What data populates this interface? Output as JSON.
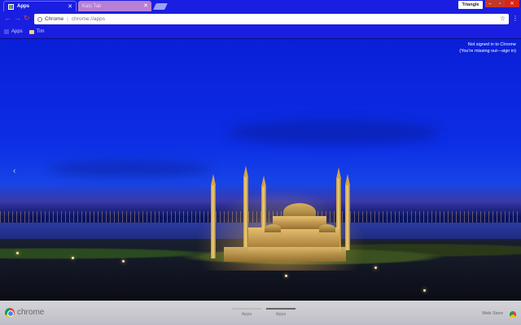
{
  "tabs": [
    {
      "label": "Apps",
      "active": true
    },
    {
      "label": "Kats Tab",
      "active": false
    }
  ],
  "profile": {
    "label": "Triangle"
  },
  "omnibox": {
    "chip": "Chrome",
    "url": "chrome://apps"
  },
  "bookmarks": [
    {
      "label": "Apps",
      "icon": "apps-grid-icon"
    },
    {
      "label": "Tim",
      "icon": "folder-icon"
    }
  ],
  "signin": {
    "line1": "Not signed in to Chrome",
    "line2": "(You're missing out—sign in)"
  },
  "bottom": {
    "brand": "chrome",
    "pages": [
      "Apps",
      "Apps"
    ],
    "webstore": "Web Store"
  },
  "colors": {
    "frame": "#1a1ee0",
    "tab_inactive": "#b87fd6",
    "close": "#d9261c"
  }
}
